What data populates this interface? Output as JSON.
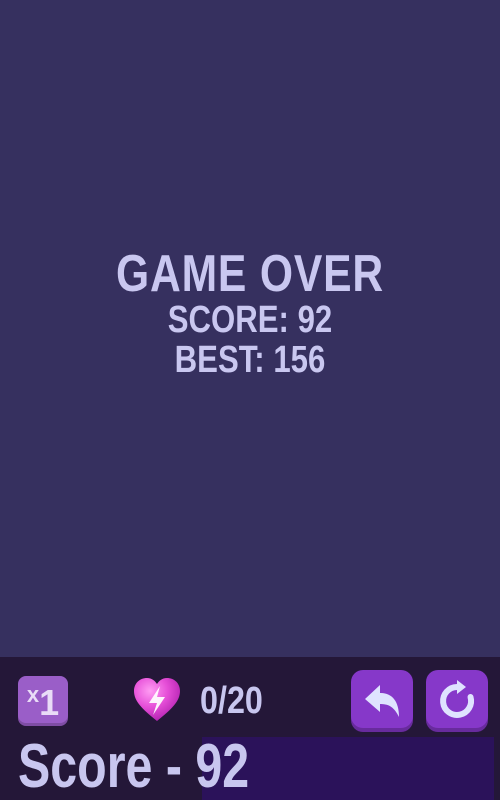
{
  "game_over": {
    "title": "GAME OVER",
    "score_text": "SCORE: 92",
    "best_text": "BEST: 156"
  },
  "bottom_bar": {
    "multiplier": {
      "x": "x",
      "value": "1"
    },
    "energy": {
      "icon": "heart-lightning-icon",
      "counter": "0/20"
    },
    "buttons": [
      {
        "icon": "undo-arrow-icon"
      },
      {
        "icon": "restart-icon"
      }
    ],
    "score": {
      "label": "Score -",
      "value": "92"
    }
  },
  "colors": {
    "background": "#36305f",
    "bar": "#241738",
    "text": "#c9c7f0",
    "button": "#8638c9",
    "multiplier_tile": "#9a5ec8",
    "heart": "#e64fd8"
  }
}
